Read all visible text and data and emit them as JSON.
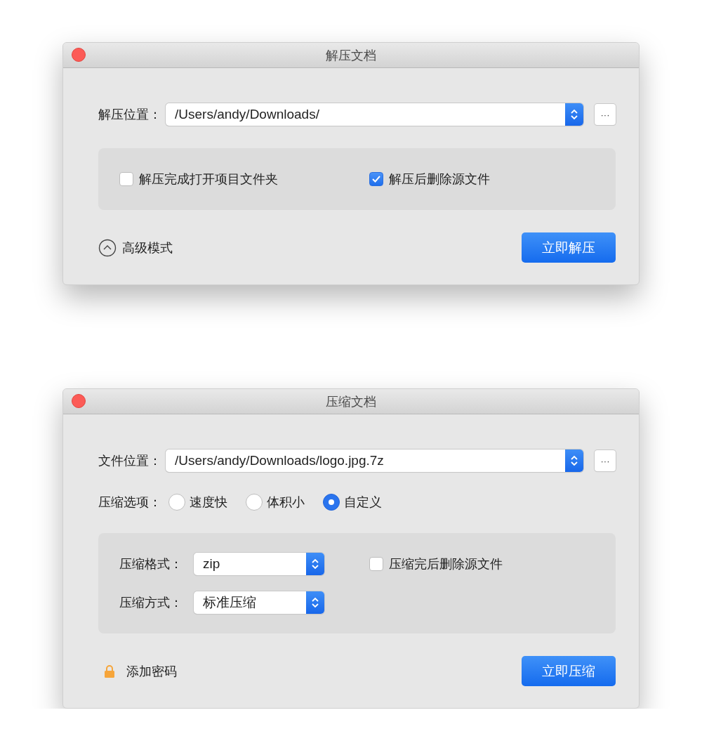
{
  "windows": [
    {
      "title": "解压文档",
      "location": {
        "label": "解压位置：",
        "value": "/Users/andy/Downloads/",
        "browse": "···"
      },
      "panel": {
        "items": [
          {
            "kind": "checkbox",
            "label": "解压完成打开项目文件夹",
            "checked": false
          },
          {
            "kind": "checkbox",
            "label": "解压后删除源文件",
            "checked": true
          }
        ]
      },
      "footer": {
        "kind": "advanced",
        "label": "高级模式"
      },
      "action": "立即解压"
    },
    {
      "title": "压缩文档",
      "location": {
        "label": "文件位置：",
        "value": "/Users/andy/Downloads/logo.jpg.7z",
        "browse": "···"
      },
      "radio": {
        "label": "压缩选项：",
        "choices": [
          {
            "label": "速度快",
            "selected": false
          },
          {
            "label": "体积小",
            "selected": false
          },
          {
            "label": "自定义",
            "selected": true
          }
        ]
      },
      "panel": {
        "items": [
          {
            "kind": "select",
            "label": "压缩格式：",
            "value": "zip"
          },
          {
            "kind": "checkbox",
            "label": "压缩完后删除源文件",
            "checked": false
          },
          {
            "kind": "select",
            "label": "压缩方式：",
            "value": "标准压缩"
          }
        ]
      },
      "footer": {
        "kind": "password",
        "label": "添加密码"
      },
      "action": "立即压缩"
    }
  ]
}
